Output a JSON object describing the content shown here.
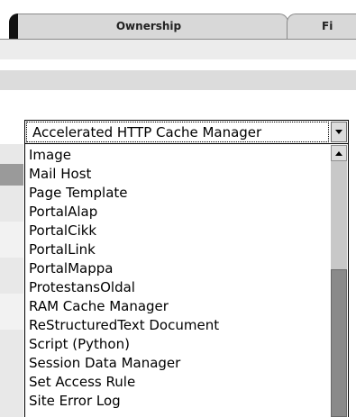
{
  "tabs": [
    {
      "label": "Ownership"
    },
    {
      "label": "Fi"
    }
  ],
  "select": {
    "value": "Accelerated HTTP Cache Manager"
  },
  "dropdown": {
    "items": [
      "Image",
      "Mail Host",
      "Page Template",
      "PortalAlap",
      "PortalCikk",
      "PortalLink",
      "PortalMappa",
      "ProtestansOldal",
      "RAM Cache Manager",
      "ReStructuredText Document",
      "Script (Python)",
      "Session Data Manager",
      "Set Access Rule",
      "Site Error Log"
    ]
  },
  "icons": {
    "select_arrow": "chevron-down-icon",
    "scroll_up": "chevron-up-icon"
  },
  "colors": {
    "tab_bg": "#d8d8d8",
    "band_light": "#ececec",
    "band_dark": "#dcdcdc",
    "scroll_thumb": "#8a8a8a"
  }
}
